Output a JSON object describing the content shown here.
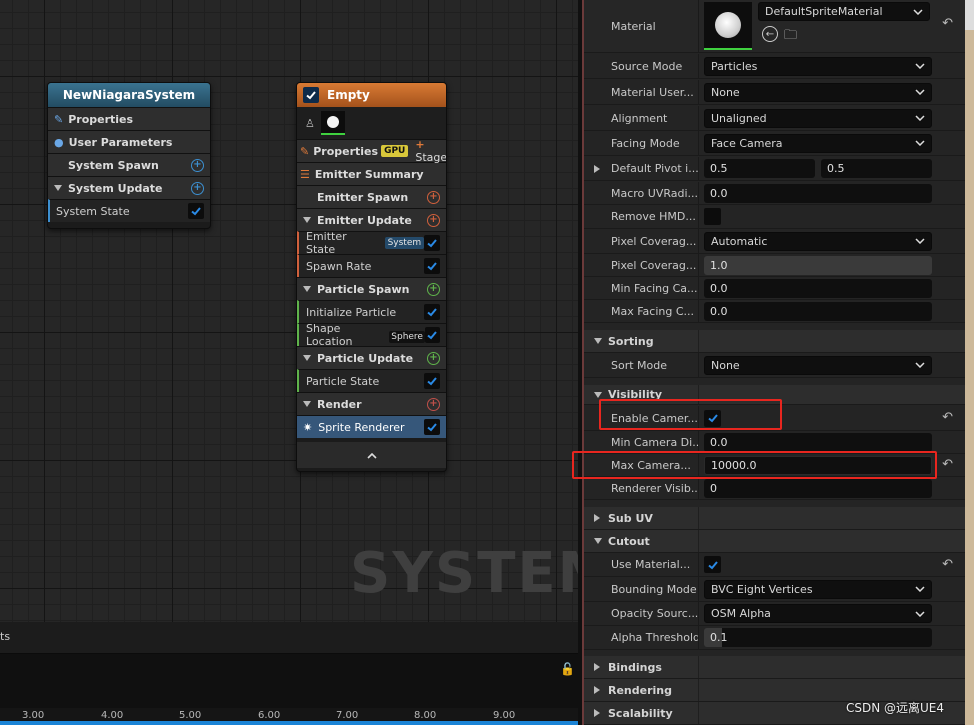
{
  "graph": {
    "watermark": "SYSTEM",
    "system_node": {
      "title": "NewNiagaraSystem",
      "rows": [
        {
          "label": "Properties",
          "kind": "section-static"
        },
        {
          "label": "User Parameters",
          "kind": "section-static"
        },
        {
          "label": "System Spawn",
          "kind": "section"
        },
        {
          "label": "System Update",
          "kind": "section"
        },
        {
          "label": "System State",
          "kind": "item"
        }
      ]
    },
    "emitter_node": {
      "title": "Empty",
      "properties_label": "Properties",
      "gpu_tag": "GPU",
      "stage_label": "Stage",
      "summary_label": "Emitter Summary",
      "emitter_spawn": "Emitter Spawn",
      "emitter_update": "Emitter Update",
      "emitter_state": "Emitter State",
      "emitter_state_tag": "System",
      "spawn_rate": "Spawn Rate",
      "particle_spawn": "Particle Spawn",
      "initialize_particle": "Initialize Particle",
      "shape_location": "Shape Location",
      "shape_location_tag": "Sphere",
      "particle_update": "Particle Update",
      "particle_state": "Particle State",
      "render": "Render",
      "sprite_renderer": "Sprite Renderer"
    }
  },
  "timeline": {
    "header_text": "ts",
    "ticks": [
      "3.00",
      "4.00",
      "5.00",
      "6.00",
      "7.00",
      "8.00",
      "9.00"
    ]
  },
  "details": {
    "material_label": "Material",
    "material_value": "DefaultSpriteMaterial",
    "source_mode": {
      "label": "Source Mode",
      "value": "Particles"
    },
    "material_user": {
      "label": "Material User...",
      "value": "None"
    },
    "alignment": {
      "label": "Alignment",
      "value": "Unaligned"
    },
    "facing_mode": {
      "label": "Facing Mode",
      "value": "Face Camera"
    },
    "default_pivot": {
      "label": "Default Pivot i...",
      "x": "0.5",
      "y": "0.5"
    },
    "macro_uv": {
      "label": "Macro UVRadi...",
      "value": "0.0"
    },
    "remove_hmd": {
      "label": "Remove HMD..."
    },
    "pixel_coverage_mode": {
      "label": "Pixel Coverag...",
      "value": "Automatic"
    },
    "pixel_coverage_blend": {
      "label": "Pixel Coverag...",
      "value": "1.0"
    },
    "min_facing": {
      "label": "Min Facing Ca...",
      "value": "0.0"
    },
    "max_facing": {
      "label": "Max Facing C...",
      "value": "0.0"
    },
    "sorting_cat": "Sorting",
    "sort_mode": {
      "label": "Sort Mode",
      "value": "None"
    },
    "visibility_cat": "Visibility",
    "enable_camera": {
      "label": "Enable Camer..."
    },
    "min_camera": {
      "label": "Min Camera Di...",
      "value": "0.0"
    },
    "max_camera": {
      "label": "Max Camera...",
      "value": "10000.0"
    },
    "renderer_vis": {
      "label": "Renderer Visib...",
      "value": "0"
    },
    "subuv_cat": "Sub UV",
    "cutout_cat": "Cutout",
    "use_material": {
      "label": "Use Material..."
    },
    "bounding_mode": {
      "label": "Bounding Mode",
      "value": "BVC Eight Vertices"
    },
    "opacity_source": {
      "label": "Opacity Sourc...",
      "value": "OSM Alpha"
    },
    "alpha_threshold": {
      "label": "Alpha Threshold",
      "value": "0.1"
    },
    "bindings_cat": "Bindings",
    "rendering_cat": "Rendering",
    "scalability_cat": "Scalability"
  },
  "watermark_csdn": "CSDN @远离UE4",
  "colors": {
    "system_header": "#2f5f78",
    "emitter_header": "#c86a2a",
    "check_blue": "#2a8ae6",
    "highlight_red": "#e8261f",
    "timeline_blue": "#1b84d6"
  }
}
